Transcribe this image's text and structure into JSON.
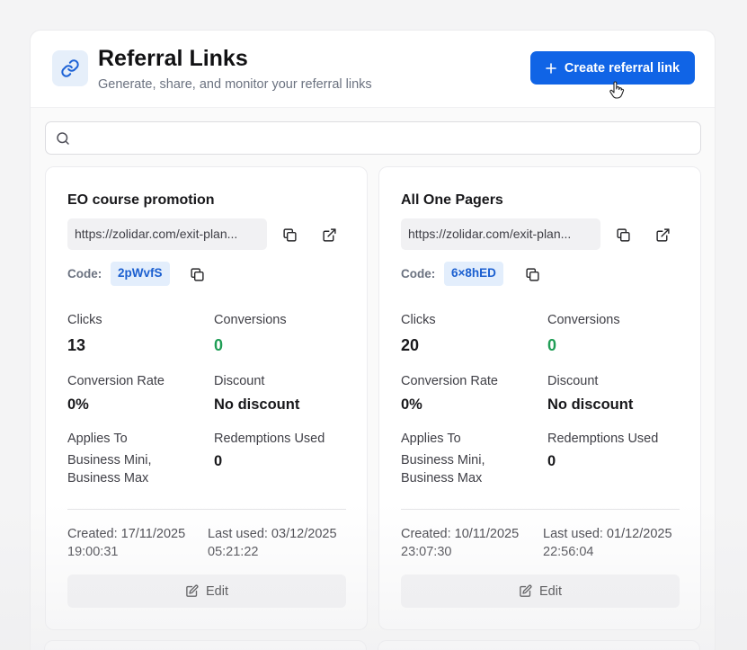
{
  "header": {
    "title": "Referral Links",
    "subtitle": "Generate, share, and monitor your referral links",
    "create_label": "Create referral link",
    "accent": "#1064e6"
  },
  "search": {
    "placeholder": "",
    "value": ""
  },
  "labels": {
    "code": "Code:",
    "clicks": "Clicks",
    "conversions": "Conversions",
    "conversion_rate": "Conversion Rate",
    "discount": "Discount",
    "applies_to": "Applies To",
    "redemptions_used": "Redemptions Used",
    "edit": "Edit"
  },
  "cards": [
    {
      "title": "EO course promotion",
      "url": "https://zolidar.com/exit-plan...",
      "code": "2pWvfS",
      "clicks": "13",
      "conversions": "0",
      "conversion_rate": "0%",
      "discount": "No discount",
      "applies_to": [
        "Business Mini,",
        "Business Max"
      ],
      "redemptions_used": "0",
      "created": [
        "Created: 17/11/2025",
        "19:00:31"
      ],
      "last_used": [
        "Last used: 03/12/2025",
        "05:21:22"
      ]
    },
    {
      "title": "All One Pagers",
      "url": "https://zolidar.com/exit-plan...",
      "code": "6×8hED",
      "clicks": "20",
      "conversions": "0",
      "conversion_rate": "0%",
      "discount": "No discount",
      "applies_to": [
        "Business Mini,",
        "Business Max"
      ],
      "redemptions_used": "0",
      "created": [
        "Created: 10/11/2025",
        "23:07:30"
      ],
      "last_used": [
        "Last used: 01/12/2025",
        "22:56:04"
      ]
    }
  ],
  "icons": {
    "header": "link-icon",
    "create": "plus-icon",
    "search": "search-icon",
    "copy": "copy-icon",
    "open": "external-link-icon",
    "edit": "edit-icon",
    "cursor": "hand-pointer-icon"
  },
  "colors": {
    "conversions_green": "#1f9d55",
    "code_badge_text": "#1b5fd0",
    "code_badge_bg": "#e3eefc"
  }
}
